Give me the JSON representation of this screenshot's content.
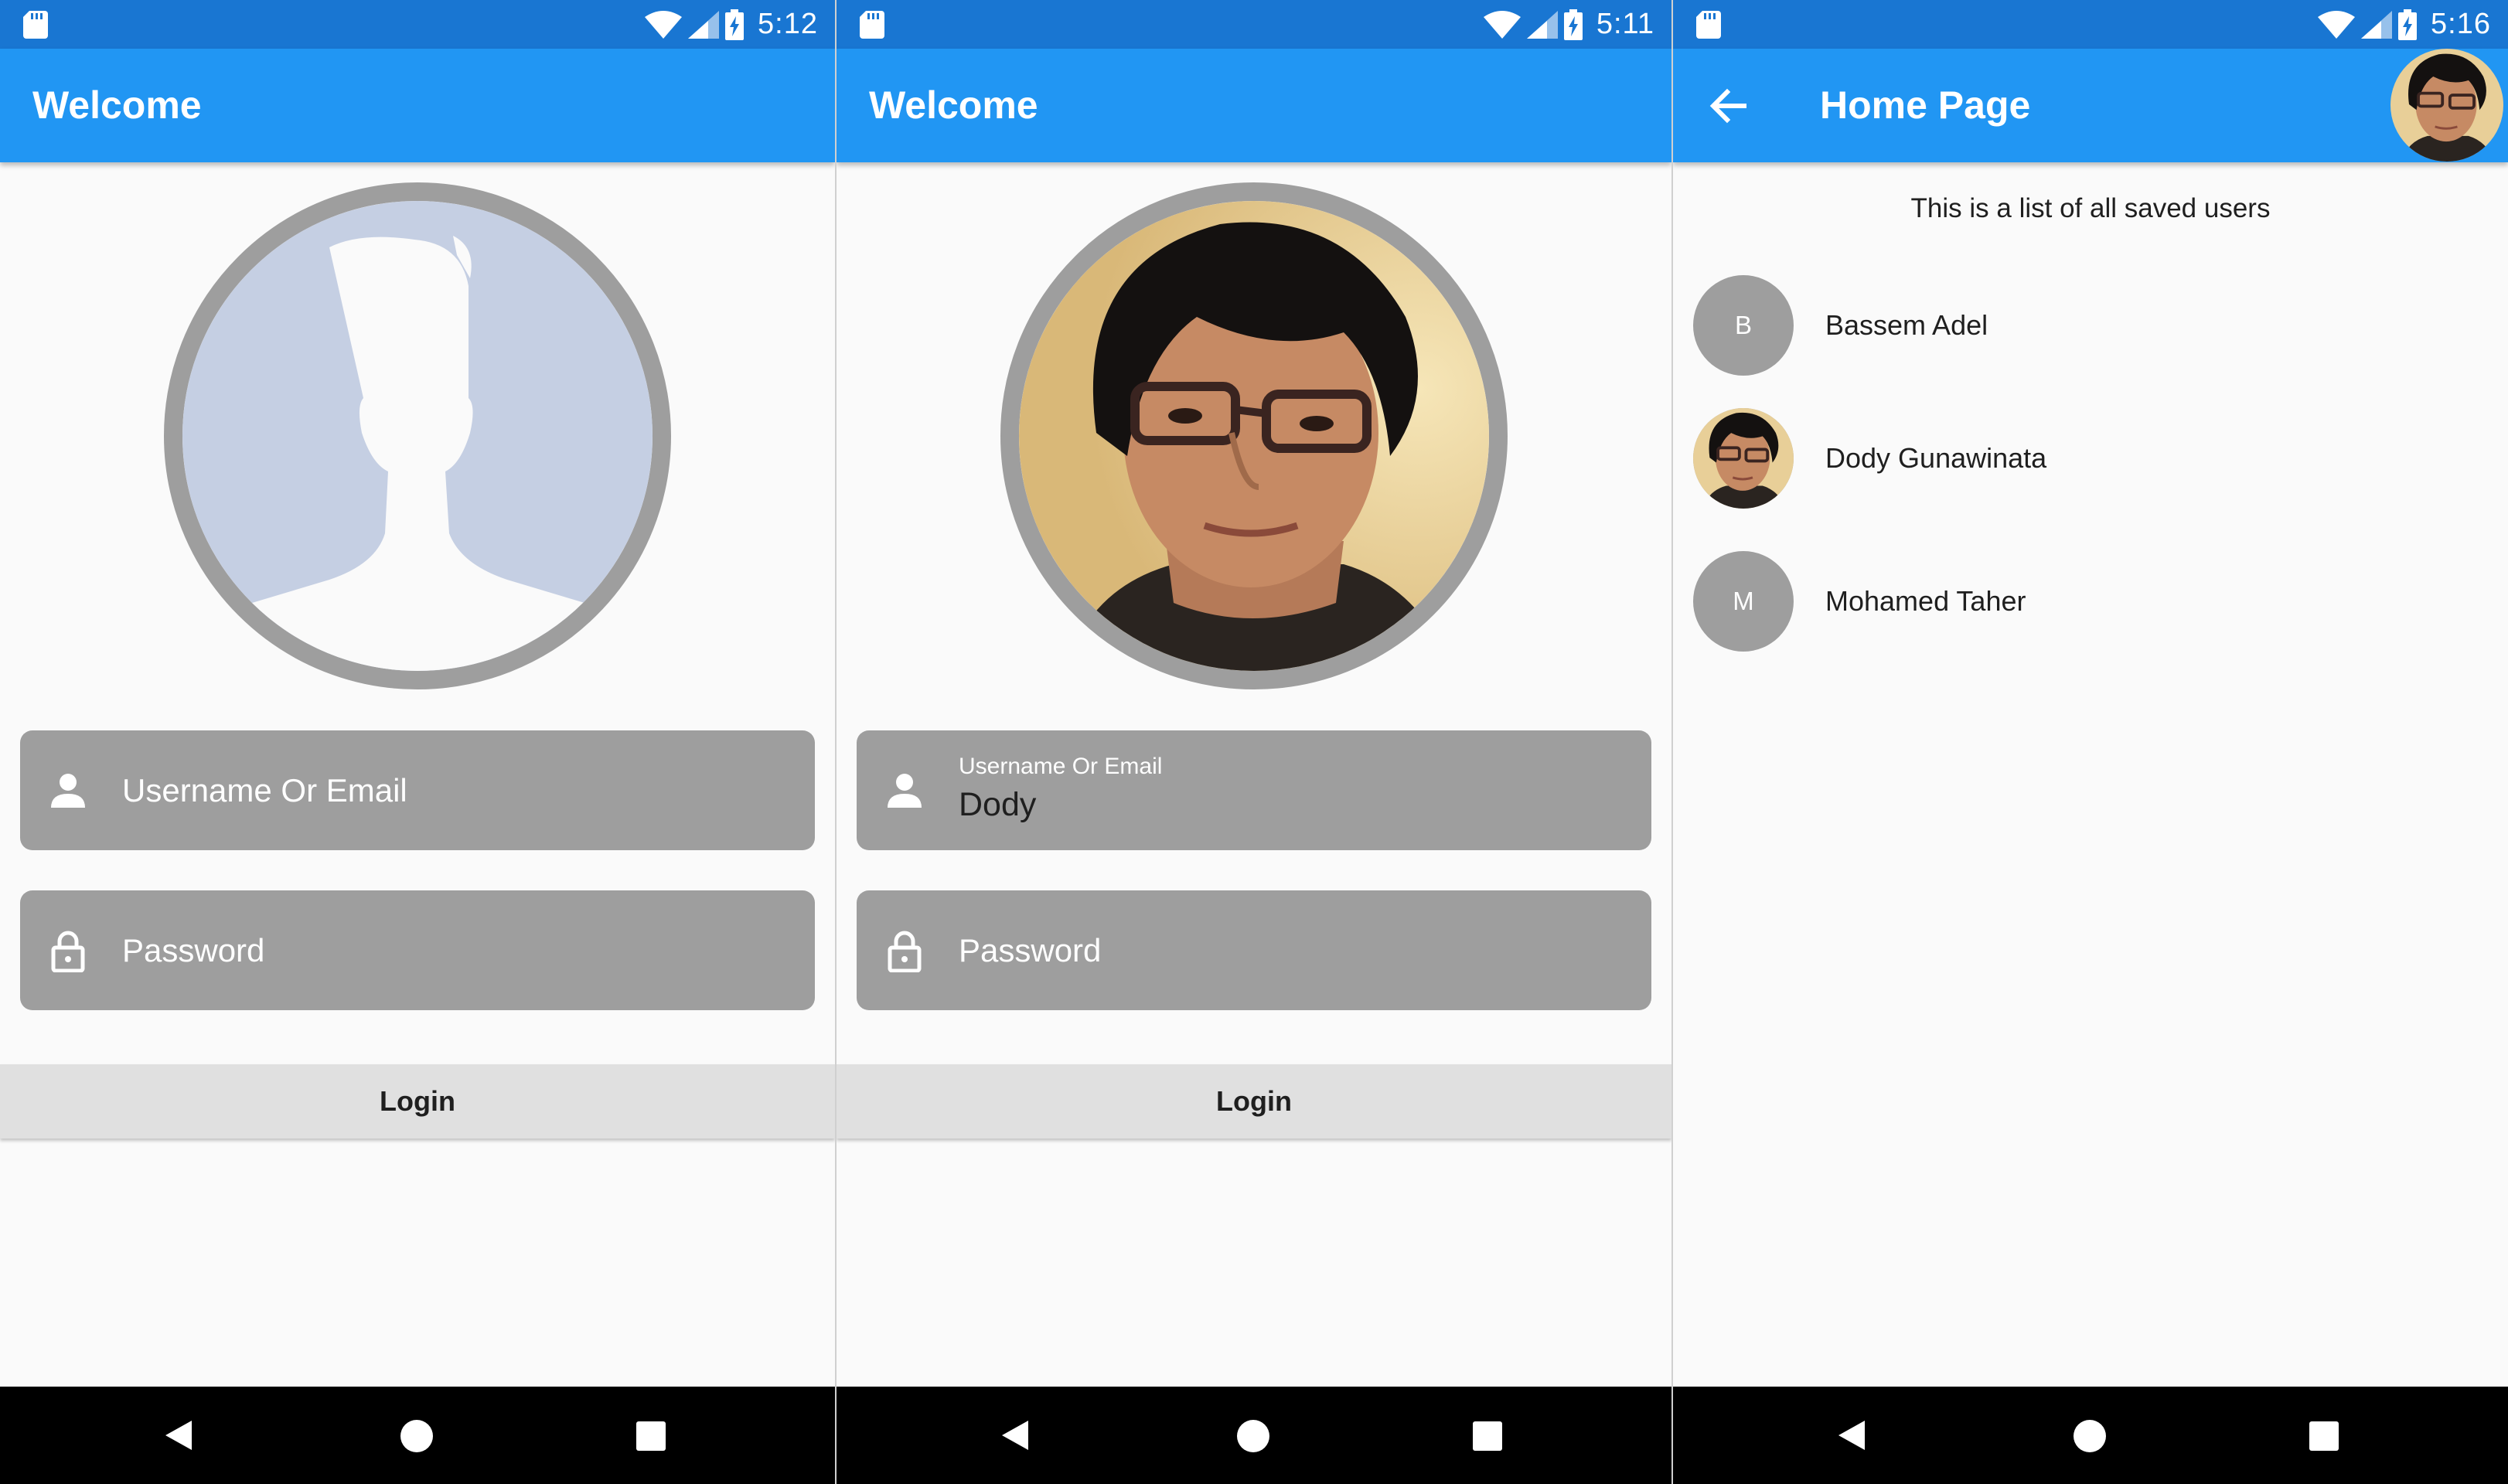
{
  "screens": [
    {
      "status_time": "5:12",
      "app_title": "Welcome",
      "username_placeholder": "Username Or Email",
      "password_placeholder": "Password",
      "login_label": "Login"
    },
    {
      "status_time": "5:11",
      "app_title": "Welcome",
      "username_label": "Username Or Email",
      "username_value": "Dody",
      "password_placeholder": "Password",
      "login_label": "Login"
    },
    {
      "status_time": "5:16",
      "app_title": "Home Page",
      "subtitle": "This is a list of all saved users",
      "users": [
        {
          "initial": "B",
          "name": "Bassem Adel"
        },
        {
          "initial": "",
          "name": "Dody Gunawinata",
          "avatar": "photo"
        },
        {
          "initial": "M",
          "name": "Mohamed Taher"
        }
      ]
    }
  ],
  "colors": {
    "status_bar": "#1976d2",
    "app_bar": "#2196f3",
    "field_bg": "#9e9e9e",
    "button_bg": "#e0e0e0",
    "avatar_placeholder_bg": "#c5cfe3"
  },
  "icons": {
    "status": [
      "sd-card-icon",
      "wifi-icon",
      "signal-icon",
      "battery-charging-icon"
    ],
    "fields": [
      "person-icon",
      "lock-icon"
    ],
    "nav": [
      "nav-back-icon",
      "nav-home-icon",
      "nav-recents-icon"
    ],
    "app_bar": [
      "back-arrow-icon"
    ]
  }
}
